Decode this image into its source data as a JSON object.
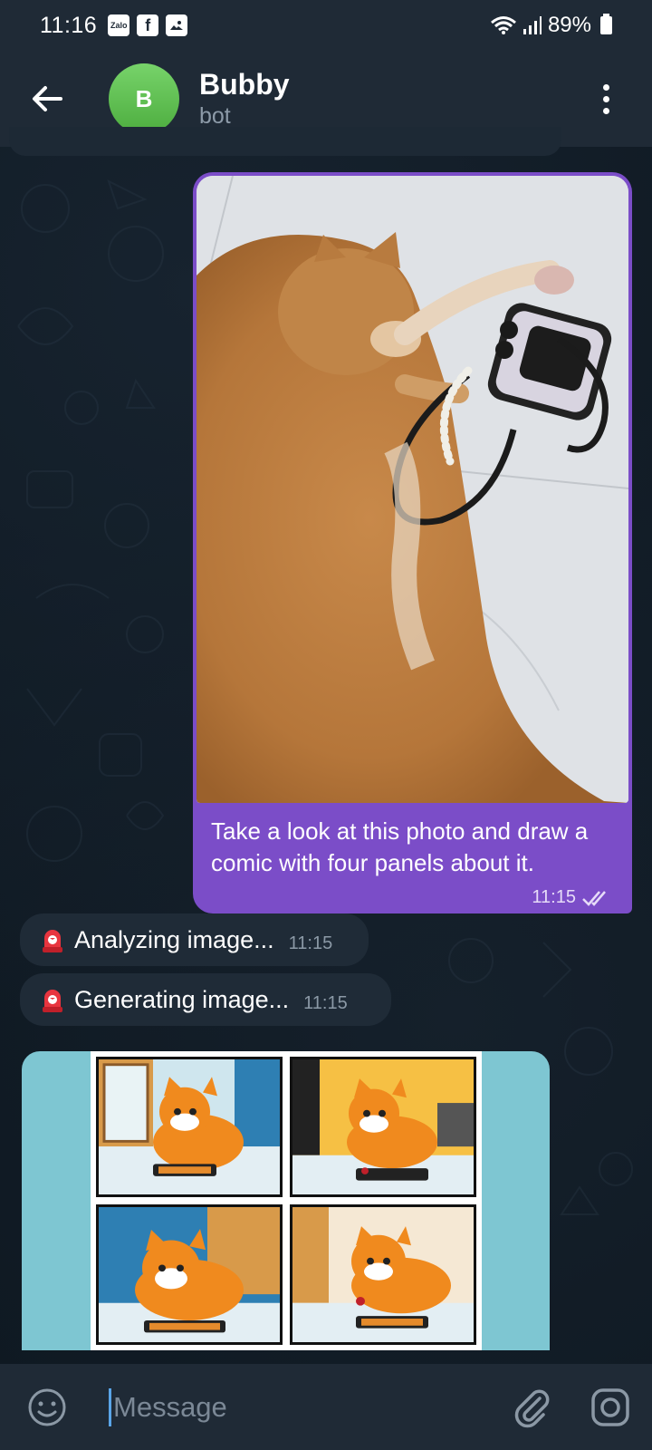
{
  "status_bar": {
    "time": "11:16",
    "app_icons": [
      "Zalo",
      "facebook-icon",
      "gallery-icon"
    ],
    "battery": "89%",
    "icons": [
      "wifi-icon",
      "signal-icon",
      "battery-icon"
    ]
  },
  "header": {
    "back_icon": "arrow-left-icon",
    "avatar_letter": "B",
    "title": "Bubby",
    "subtitle": "bot",
    "menu_icon": "more-vertical-icon"
  },
  "messages": {
    "outgoing": {
      "text": "Take a look at this photo and draw a comic with four panels about it.",
      "time": "11:15",
      "status_icon": "double-check-icon"
    },
    "incoming": [
      {
        "icon": "siren-icon",
        "text": "Analyzing image...",
        "time": "11:15"
      },
      {
        "icon": "siren-icon",
        "text": "Generating image...",
        "time": "11:15"
      }
    ]
  },
  "input_bar": {
    "placeholder": "Message",
    "emoji_icon": "emoji-icon",
    "attach_icon": "paperclip-icon",
    "camera_icon": "camera-icon"
  },
  "colors": {
    "header_bg": "#1f2a36",
    "outgoing_bubble": "#7b4dc8",
    "incoming_bubble": "#1f2b37",
    "avatar": "#5ec04f",
    "chat_bg": "#0e1821"
  }
}
